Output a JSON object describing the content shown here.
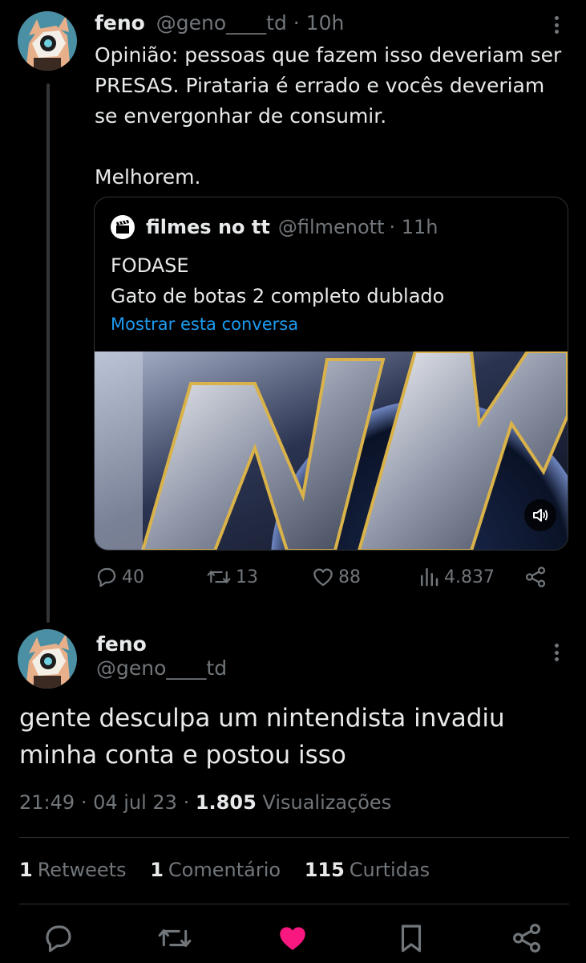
{
  "first_tweet": {
    "name": "feno",
    "handle": "@geno____td",
    "time": "· 10h",
    "text_line1": "Opinião: pessoas que fazem isso deveriam ser",
    "text_line2": "PRESAS. Pirataria é errado e vocês deveriam",
    "text_line3": "se envergonhar de consumir.",
    "text_line4": "Melhorem.",
    "quote": {
      "name": "filmes no tt",
      "handle": "@filmenott",
      "time": "· 11h",
      "line1": "FODASE",
      "line2": "Gato de botas 2 completo dublado",
      "show_thread": "Mostrar esta conversa"
    },
    "actions": {
      "replies": "40",
      "retweets": "13",
      "likes": "88",
      "views": "4.837"
    }
  },
  "second_tweet": {
    "name": "feno",
    "handle": "@geno____td",
    "text_line1": "gente desculpa um nintendista invadiu",
    "text_line2": "minha conta e postou isso",
    "time": "21:49",
    "date": "· 04 jul 23 ·",
    "views_count": "1.805",
    "views_label": "Visualizações",
    "retweets_count": "1",
    "retweets_label": "Retweets",
    "comments_count": "1",
    "comments_label": "Comentário",
    "likes_count": "115",
    "likes_label": "Curtidas"
  },
  "icons": {
    "reply": "reply-icon",
    "retweet": "retweet-icon",
    "like": "heart-icon",
    "views": "views-icon",
    "share": "share-icon",
    "bookmark": "bookmark-icon",
    "more": "more-icon",
    "mute": "speaker-icon"
  },
  "colors": {
    "background": "#000000",
    "text": "#e7e9ea",
    "muted": "#71767b",
    "link": "#1d9bf0",
    "like_active": "#f91880"
  }
}
